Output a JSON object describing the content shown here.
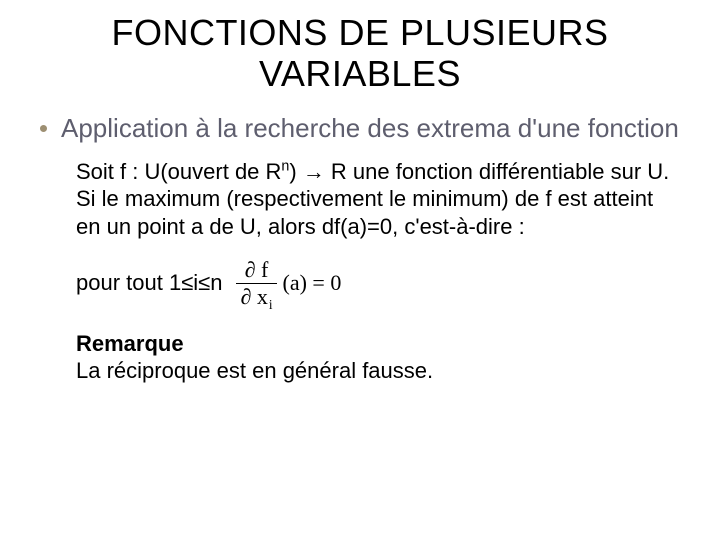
{
  "title": "FONCTIONS DE PLUSIEURS VARIABLES",
  "bullet": "Application à la recherche des extrema d'une fonction",
  "para1_a": "Soit f : U(ouvert de R",
  "para1_sup": "n",
  "para1_b": ") → R une fonction différentiable sur U.",
  "para2": "Si le maximum (respectivement le minimum) de f est atteint en un point a de U, alors df(a)=0, c'est-à-dire :",
  "pourtout": "pour tout 1≤i≤n",
  "frac_num_a": "∂ f",
  "frac_den_a": "∂ x",
  "frac_den_sub": "i",
  "formula_tail": "(a) = 0",
  "remark_label": "Remarque",
  "remark_text": "La réciproque est en général fausse."
}
